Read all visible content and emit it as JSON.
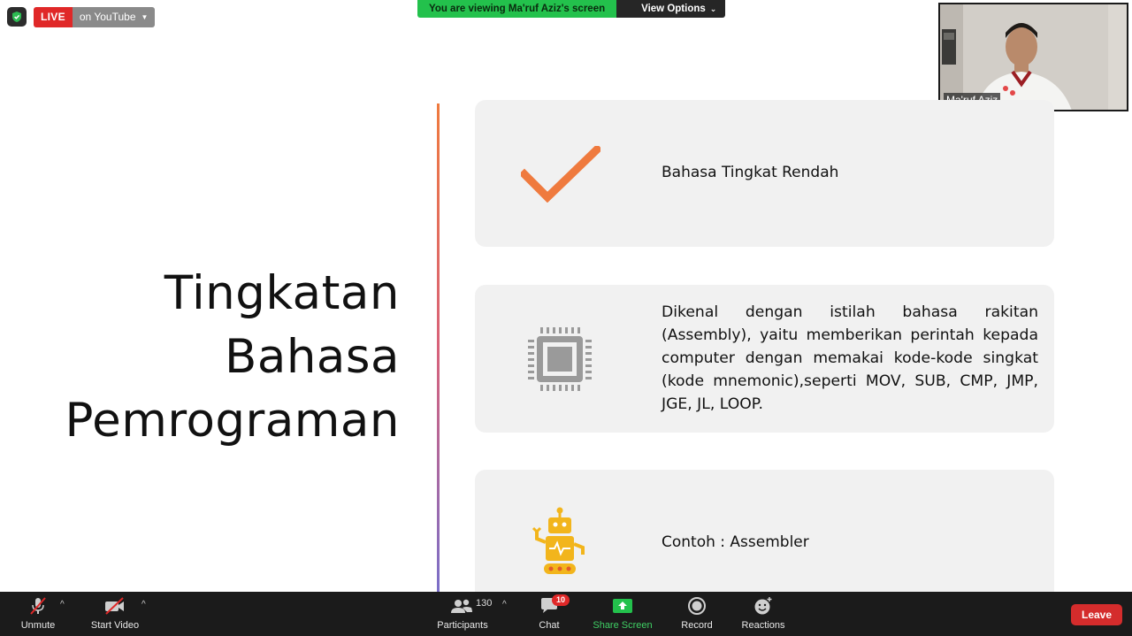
{
  "status": {
    "live_label": "LIVE",
    "destination_label": "on YouTube"
  },
  "banner": {
    "viewing_text": "You are viewing Ma'ruf Aziz's screen",
    "options_label": "View Options"
  },
  "speaker": {
    "name": "Ma'ruf Aziz"
  },
  "slide": {
    "title_lines": [
      "Tingkatan",
      "Bahasa",
      "Pemrograman"
    ],
    "cards": [
      {
        "icon": "checkmark-icon",
        "text": "Bahasa Tingkat Rendah"
      },
      {
        "icon": "cpu-chip-icon",
        "text": "Dikenal dengan istilah bahasa rakitan (Assembly), yaitu memberikan perintah kepada computer dengan memakai kode-kode singkat (kode mnemonic),seperti MOV, SUB, CMP, JMP, JGE, JL, LOOP."
      },
      {
        "icon": "robot-icon",
        "text": "Contoh : Assembler"
      }
    ]
  },
  "toolbar": {
    "unmute_label": "Unmute",
    "start_video_label": "Start Video",
    "participants_label": "Participants",
    "participants_count": "130",
    "chat_label": "Chat",
    "chat_badge": "10",
    "share_label": "Share Screen",
    "record_label": "Record",
    "reactions_label": "Reactions",
    "leave_label": "Leave"
  },
  "colors": {
    "accent_orange": "#ef7a3e",
    "live_red": "#e02828",
    "share_green": "#23c14c",
    "robot_yellow": "#f2b51c",
    "chip_gray": "#9a9a9a"
  }
}
